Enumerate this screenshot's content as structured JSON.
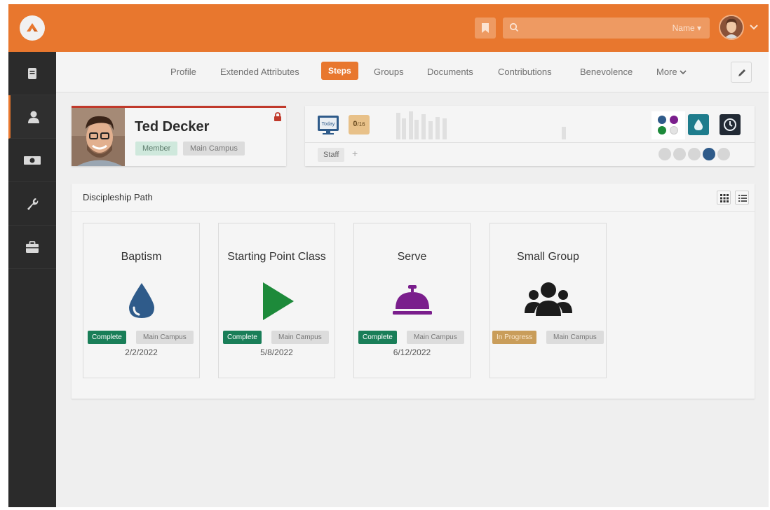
{
  "header": {
    "search_filter": "Name",
    "colors": {
      "brand": "#e8772e"
    }
  },
  "sidebar": {
    "items": [
      {
        "icon": "book-icon"
      },
      {
        "icon": "person-icon",
        "active": true
      },
      {
        "icon": "money-icon"
      },
      {
        "icon": "wrench-icon"
      },
      {
        "icon": "briefcase-icon"
      }
    ]
  },
  "tabs": [
    "Profile",
    "Extended Attributes",
    "Steps",
    "Groups",
    "Documents",
    "Contributions",
    "Benevolence",
    "More"
  ],
  "active_tab": "Steps",
  "person": {
    "name": "Ted Decker",
    "record_status": "Member",
    "campus": "Main Campus"
  },
  "stats": {
    "today_label": "Today",
    "weeks_value": "0",
    "weeks_unit": "/16",
    "tag": "Staff",
    "add_tag": "+"
  },
  "panel": {
    "title": "Discipleship Path"
  },
  "steps": [
    {
      "title": "Baptism",
      "icon": "water-drop-icon",
      "color": "#2f5b8a",
      "status": "Complete",
      "campus": "Main Campus",
      "date": "2/2/2022"
    },
    {
      "title": "Starting Point Class",
      "icon": "play-icon",
      "color": "#1d8a3a",
      "status": "Complete",
      "campus": "Main Campus",
      "date": "5/8/2022"
    },
    {
      "title": "Serve",
      "icon": "bell-icon",
      "color": "#7a1e8c",
      "status": "Complete",
      "campus": "Main Campus",
      "date": "6/12/2022"
    },
    {
      "title": "Small Group",
      "icon": "users-icon",
      "color": "#1c1c1c",
      "status": "In Progress",
      "campus": "Main Campus",
      "date": ""
    }
  ]
}
